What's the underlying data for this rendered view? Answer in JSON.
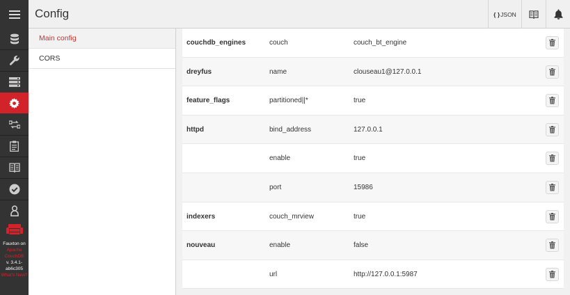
{
  "header": {
    "title": "Config",
    "json_label": "JSON",
    "json_braces": "{ }"
  },
  "nav": {
    "icons": [
      "menu-icon",
      "database-icon",
      "wrench-icon",
      "server-icon",
      "gear-icon",
      "replication-icon",
      "clipboard-icon",
      "book-icon",
      "check-circle-icon",
      "user-icon"
    ],
    "active": "gear-icon",
    "footer": {
      "line1": "Fauxton on",
      "line2": "Apache",
      "line3": "CouchDB",
      "line4": "v. 3.4.1-",
      "line5": "ab6c305",
      "line6": "What's New?"
    }
  },
  "sidebar": {
    "items": [
      {
        "label": "Main config",
        "active": true
      },
      {
        "label": "CORS",
        "active": false
      }
    ]
  },
  "config_rows": [
    {
      "section": "couchdb_engines",
      "option": "couch",
      "value": "couch_bt_engine"
    },
    {
      "section": "dreyfus",
      "option": "name",
      "value": "clouseau1@127.0.0.1"
    },
    {
      "section": "feature_flags",
      "option": "partitioned||*",
      "value": "true"
    },
    {
      "section": "httpd",
      "option": "bind_address",
      "value": "127.0.0.1"
    },
    {
      "section": "",
      "option": "enable",
      "value": "true"
    },
    {
      "section": "",
      "option": "port",
      "value": "15986"
    },
    {
      "section": "indexers",
      "option": "couch_mrview",
      "value": "true"
    },
    {
      "section": "nouveau",
      "option": "enable",
      "value": "false"
    },
    {
      "section": "",
      "option": "url",
      "value": "http://127.0.0.1:5987"
    }
  ],
  "colors": {
    "rail": "#333333",
    "accent": "#d2232a",
    "active_text": "#c33331"
  }
}
